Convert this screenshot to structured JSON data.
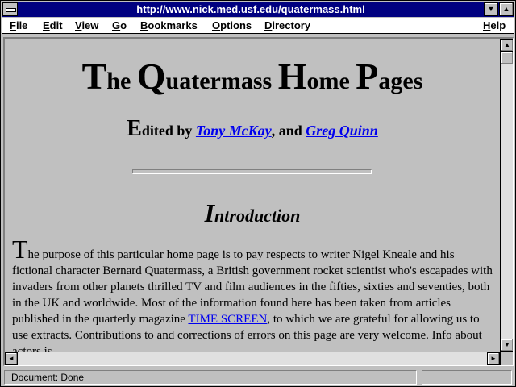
{
  "window": {
    "title": "http://www.nick.med.usf.edu/quatermass.html"
  },
  "titlebar_icons": {
    "minimize": "▼",
    "maximize": "▲"
  },
  "menu": {
    "items": [
      {
        "key": "F",
        "rest": "ile"
      },
      {
        "key": "E",
        "rest": "dit"
      },
      {
        "key": "V",
        "rest": "iew"
      },
      {
        "key": "G",
        "rest": "o"
      },
      {
        "key": "B",
        "rest": "ookmarks"
      },
      {
        "key": "O",
        "rest": "ptions"
      },
      {
        "key": "D",
        "rest": "irectory"
      },
      {
        "key": "H",
        "rest": "elp"
      }
    ]
  },
  "page": {
    "title": {
      "w1_first": "T",
      "w1_rest": "he",
      "w2_first": "Q",
      "w2_rest": "uatermass",
      "w3_first": "H",
      "w3_rest": "ome",
      "w4_first": "P",
      "w4_rest": "ages"
    },
    "editors": {
      "drop": "E",
      "prefix": "dited by ",
      "editor1": "Tony McKay",
      "sep": ", and ",
      "editor2": "Greg Quinn"
    },
    "section": {
      "drop": "I",
      "rest": "ntroduction"
    },
    "body": {
      "drop": "T",
      "text_before_link": "he purpose of this particular home page is to pay respects to writer Nigel Kneale and his fictional character Bernard Quatermass, a British government rocket scientist who's escapades with invaders from other planets thrilled TV and film audiences in the fifties, sixties and seventies, both in the UK and worldwide. Most of the information found here has been taken from articles published in the quarterly magazine ",
      "link": "TIME SCREEN",
      "text_after_link": ", to which we are grateful for allowing us to use extracts. Contributions to and corrections of errors on this page are very welcome. Info about actors is"
    }
  },
  "scroll_icons": {
    "up": "▲",
    "down": "▼",
    "left": "◄",
    "right": "►"
  },
  "status": {
    "text": "Document: Done"
  }
}
